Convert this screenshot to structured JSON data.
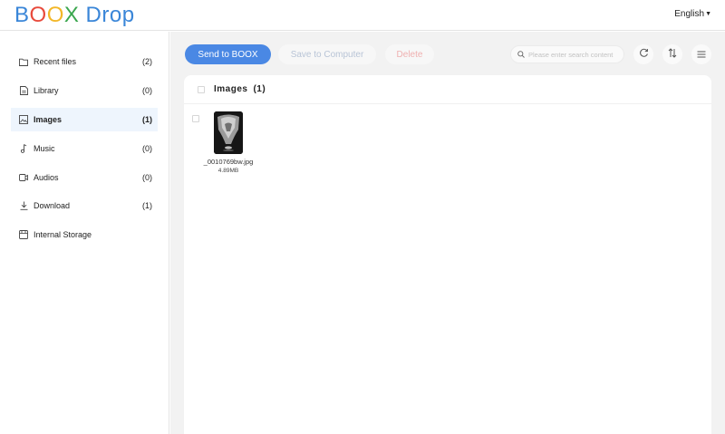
{
  "header": {
    "logo": {
      "letters": [
        {
          "char": "B",
          "color": "#3a86d8"
        },
        {
          "char": "O",
          "color": "#e84a3c"
        },
        {
          "char": "O",
          "color": "#f3b728"
        },
        {
          "char": "X",
          "color": "#3aa64e"
        },
        {
          "char": " Drop",
          "color": "#3a86d8"
        }
      ]
    },
    "language": "English"
  },
  "sidebar": {
    "items": [
      {
        "label": "Recent files",
        "count": "(2)",
        "icon": "folder-icon"
      },
      {
        "label": "Library",
        "count": "(0)",
        "icon": "document-icon"
      },
      {
        "label": "Images",
        "count": "(1)",
        "icon": "image-icon",
        "active": true
      },
      {
        "label": "Music",
        "count": "(0)",
        "icon": "music-note-icon"
      },
      {
        "label": "Audios",
        "count": "(0)",
        "icon": "video-icon"
      },
      {
        "label": "Download",
        "count": "(1)",
        "icon": "download-icon"
      },
      {
        "label": "Internal Storage",
        "count": "",
        "icon": "storage-icon"
      }
    ]
  },
  "toolbar": {
    "send_label": "Send to BOOX",
    "save_label": "Save to Computer",
    "delete_label": "Delete",
    "search_placeholder": "Please enter search content",
    "refresh_icon": "refresh-icon",
    "sort_icon": "sort-icon",
    "view_icon": "list-view-icon"
  },
  "panel": {
    "title": "Images",
    "count": "(1)",
    "files": [
      {
        "name": "_0010769bw.jpg",
        "size": "4.89MB"
      }
    ]
  },
  "colors": {
    "accent": "#4a88e4",
    "active_bg": "#eef5fd",
    "delete_disabled": "#efb0b0"
  }
}
